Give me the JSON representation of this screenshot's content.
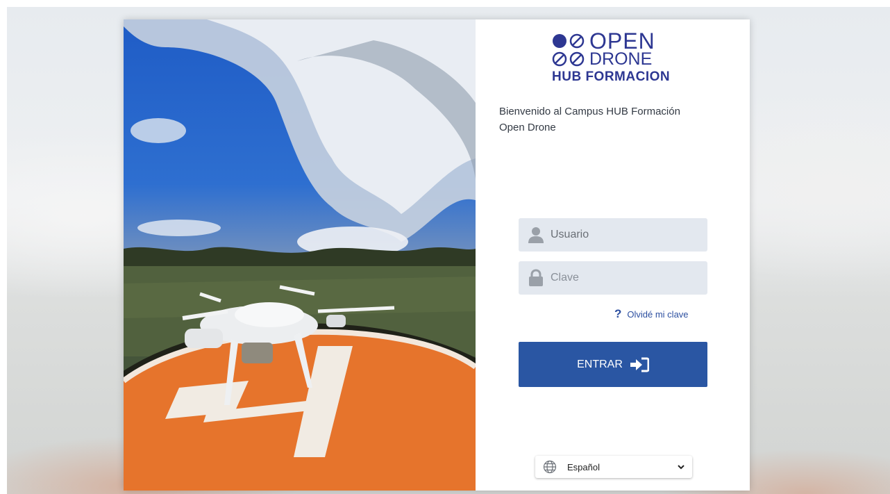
{
  "logo": {
    "line1": "OPEN",
    "line2": "DRONE",
    "line3": "HUB FORMACION",
    "color": "#2d3792"
  },
  "welcome": {
    "line1": "Bienvenido al Campus HUB Formación",
    "line2": "Open Drone"
  },
  "login": {
    "username_placeholder": "Usuario",
    "password_placeholder": "Clave",
    "forgot_label": "Olvidé mi clave",
    "submit_label": "ENTRAR"
  },
  "language": {
    "selected": "Español"
  },
  "colors": {
    "accent": "#2a56a3",
    "field_bg": "#e3e8ef",
    "link": "#2c4fa0"
  }
}
